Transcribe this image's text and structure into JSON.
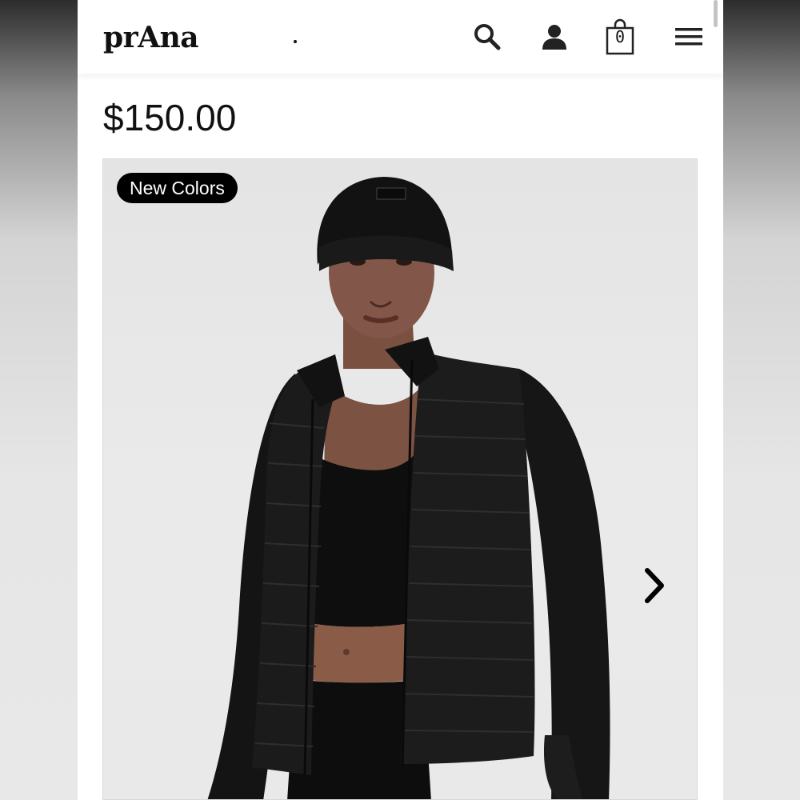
{
  "brand": {
    "logo_text": "prAna"
  },
  "header": {
    "icons": [
      "search-icon",
      "account-icon",
      "cart-icon",
      "menu-icon"
    ],
    "cart_count": "0"
  },
  "product": {
    "price": "$150.00",
    "badge": "New Colors"
  },
  "colors": {
    "badge_bg": "#000000",
    "text": "#111111",
    "image_bg": "#e8e8e8"
  }
}
